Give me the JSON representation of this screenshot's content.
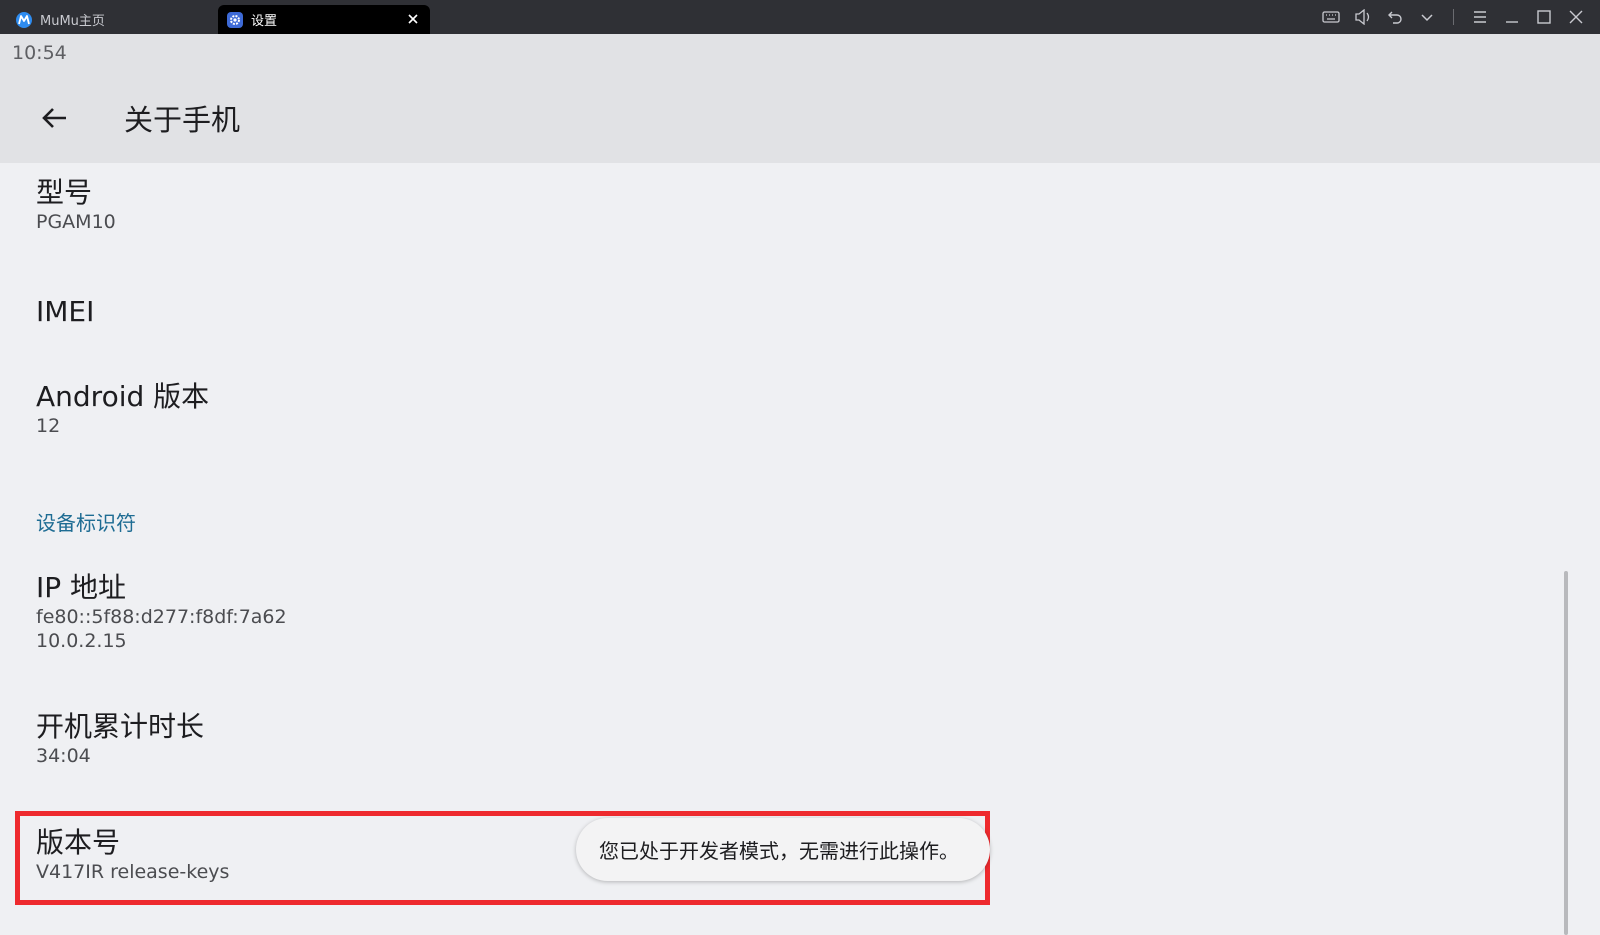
{
  "window": {
    "tabs": [
      {
        "label": "MuMu主页",
        "active": false
      },
      {
        "label": "设置",
        "active": true
      }
    ],
    "controls": [
      "keyboard-icon",
      "volume-icon",
      "undo-icon",
      "chevron-down-icon",
      "menu-icon",
      "minimize-icon",
      "maximize-icon",
      "close-icon"
    ]
  },
  "status_bar": {
    "time": "10:54"
  },
  "app_bar": {
    "title": "关于手机"
  },
  "items": [
    {
      "title": "型号",
      "subtitle": "PGAM10"
    },
    {
      "title": "IMEI",
      "subtitle": ""
    },
    {
      "title": "Android 版本",
      "subtitle": "12"
    }
  ],
  "section": {
    "header": "设备标识符"
  },
  "ip_item": {
    "title": "IP 地址",
    "lines": [
      "fe80::5f88:d277:f8df:7a62",
      "10.0.2.15"
    ]
  },
  "uptime_item": {
    "title": "开机累计时长",
    "subtitle": "34:04"
  },
  "build_item": {
    "title": "版本号",
    "subtitle": "V417IR release-keys"
  },
  "toast": {
    "message": "您已处于开发者模式，无需进行此操作。"
  },
  "colors": {
    "accent": "#1e6c93",
    "highlight": "#ee2a2e",
    "titlebar": "#2f3035"
  }
}
